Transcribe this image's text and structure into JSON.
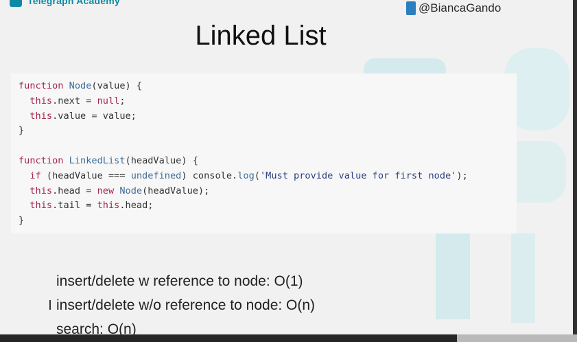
{
  "header": {
    "logo_text": "Telegraph Academy",
    "twitter_handle": "@BiancaGando"
  },
  "slide": {
    "title": "Linked List",
    "code_lines": [
      [
        {
          "t": "function ",
          "c": "kw"
        },
        {
          "t": "Node",
          "c": "fn"
        },
        {
          "t": "(value) {",
          "c": ""
        }
      ],
      [
        {
          "t": "  this",
          "c": "kw"
        },
        {
          "t": ".next = ",
          "c": ""
        },
        {
          "t": "null",
          "c": "lit"
        },
        {
          "t": ";",
          "c": ""
        }
      ],
      [
        {
          "t": "  this",
          "c": "kw"
        },
        {
          "t": ".value = value;",
          "c": ""
        }
      ],
      [
        {
          "t": "}",
          "c": ""
        }
      ],
      [],
      [
        {
          "t": "function ",
          "c": "kw"
        },
        {
          "t": "LinkedList",
          "c": "fn"
        },
        {
          "t": "(headValue) {",
          "c": ""
        }
      ],
      [
        {
          "t": "  if ",
          "c": "kw"
        },
        {
          "t": "(headValue === ",
          "c": ""
        },
        {
          "t": "undefined",
          "c": "fn"
        },
        {
          "t": ") console.",
          "c": ""
        },
        {
          "t": "log",
          "c": "fn"
        },
        {
          "t": "(",
          "c": ""
        },
        {
          "t": "'Must provide value for first node'",
          "c": "str"
        },
        {
          "t": ");",
          "c": ""
        }
      ],
      [
        {
          "t": "  this",
          "c": "kw"
        },
        {
          "t": ".head = ",
          "c": ""
        },
        {
          "t": "new ",
          "c": "kw"
        },
        {
          "t": "Node",
          "c": "fn"
        },
        {
          "t": "(headValue);",
          "c": ""
        }
      ],
      [
        {
          "t": "  this",
          "c": "kw"
        },
        {
          "t": ".tail = ",
          "c": ""
        },
        {
          "t": "this",
          "c": "kw"
        },
        {
          "t": ".head;",
          "c": ""
        }
      ],
      [
        {
          "t": "}",
          "c": ""
        }
      ]
    ],
    "bullets": [
      "insert/delete w reference to node: O(1)",
      "insert/delete w/o reference to node: O(n)",
      "search: O(n)"
    ]
  }
}
